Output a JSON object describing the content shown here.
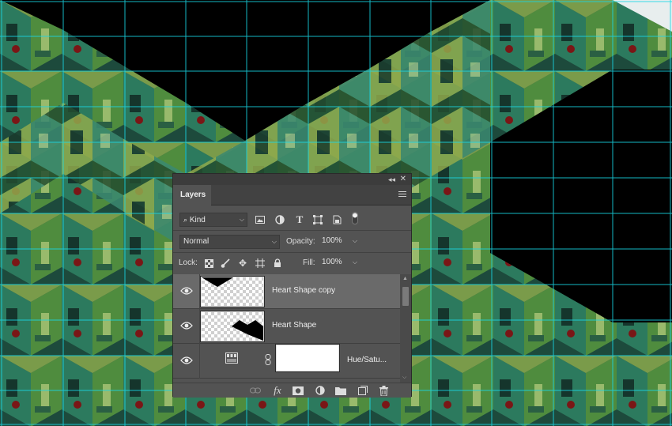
{
  "panel": {
    "tab_label": "Layers",
    "collapse_glyph": "◂◂",
    "close_glyph": "✕",
    "menu_icon": "hamburger-menu-icon"
  },
  "filter": {
    "kind_label": "Kind",
    "icons": [
      "search-icon",
      "image-filter-icon",
      "adjustment-filter-icon",
      "type-filter-icon",
      "shape-filter-icon",
      "smart-object-filter-icon",
      "filter-toggle-icon"
    ]
  },
  "blend": {
    "mode": "Normal",
    "opacity_label": "Opacity:",
    "opacity_value": "100%"
  },
  "lock": {
    "label": "Lock:",
    "fill_label": "Fill:",
    "fill_value": "100%",
    "icons": [
      "lock-transparent-icon",
      "lock-paint-icon",
      "lock-position-icon",
      "lock-artboard-icon",
      "lock-all-icon"
    ]
  },
  "layers": [
    {
      "name": "Heart Shape copy",
      "selected": true
    },
    {
      "name": "Heart Shape",
      "selected": false
    },
    {
      "name": "Hue/Satu...",
      "selected": false
    }
  ],
  "bottom_icons": [
    "link-icon",
    "fx-icon",
    "mask-icon",
    "adjustment-icon",
    "folder-icon",
    "new-layer-icon",
    "trash-icon"
  ],
  "bottom_fx_label": "fx",
  "colors": {
    "guide": "#19d8e6",
    "panel_bg": "#535353",
    "selected_layer": "#6a6a6a"
  }
}
